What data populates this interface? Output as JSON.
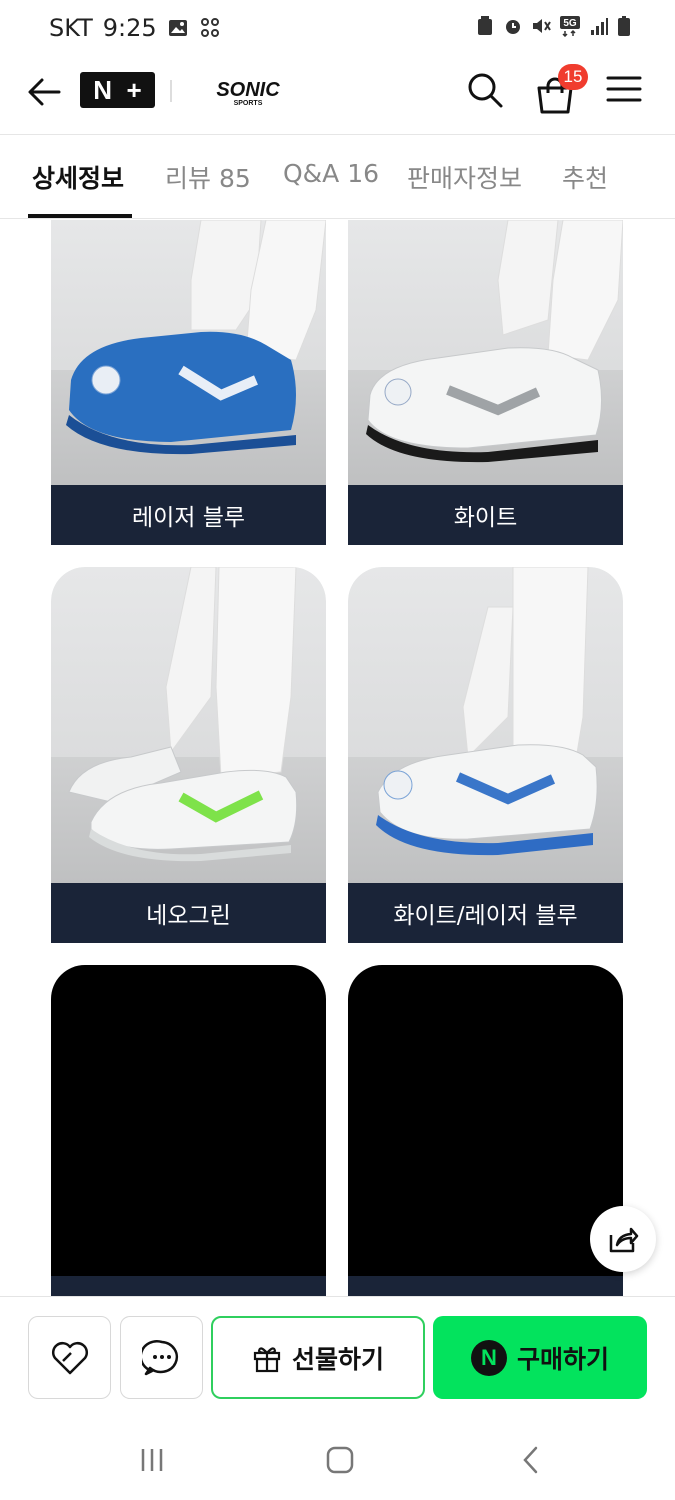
{
  "status_bar": {
    "carrier": "SKT",
    "time": "9:25",
    "network": "5G",
    "icons": [
      "gallery-icon",
      "shortcut-icon",
      "recycle-icon",
      "alarm-icon",
      "mute-icon",
      "5g-icon",
      "signal-icon",
      "battery-icon"
    ]
  },
  "header": {
    "back_icon": "arrow-left-icon",
    "nplus_logo": [
      "N",
      "+"
    ],
    "brand_logo_text": "SONIC",
    "brand_logo_sub": "SPORTS",
    "cart_count": "15",
    "icons": [
      "search-icon",
      "shopping-bag-icon",
      "hamburger-menu-icon"
    ]
  },
  "tabs": [
    {
      "label": "상세정보",
      "active": true
    },
    {
      "label": "리뷰 85",
      "active": false
    },
    {
      "label": "Q&A 16",
      "active": false
    },
    {
      "label": "판매자정보",
      "active": false
    },
    {
      "label": "추천",
      "active": false
    }
  ],
  "products": [
    {
      "label": "레이저 블루",
      "shoe_color": "#2a6fc0",
      "accent": "#e8eef7"
    },
    {
      "label": "화이트",
      "shoe_color": "#f4f5f5",
      "accent": "#9fa3a6"
    },
    {
      "label": "네오그린",
      "shoe_color": "#f4f5f5",
      "accent": "#7ee24a"
    },
    {
      "label": "화이트/레이저 블루",
      "shoe_color": "#f4f5f5",
      "accent": "#3a76c9"
    }
  ],
  "bottom_bar": {
    "gift_label": "선물하기",
    "buy_label": "구매하기",
    "buy_badge": "N",
    "icons": [
      "heart-icon",
      "chat-icon",
      "gift-icon"
    ],
    "accent_color": "#03e35d"
  },
  "nav_bar": {
    "icons": [
      "recent-apps-icon",
      "home-icon",
      "back-nav-icon"
    ]
  }
}
